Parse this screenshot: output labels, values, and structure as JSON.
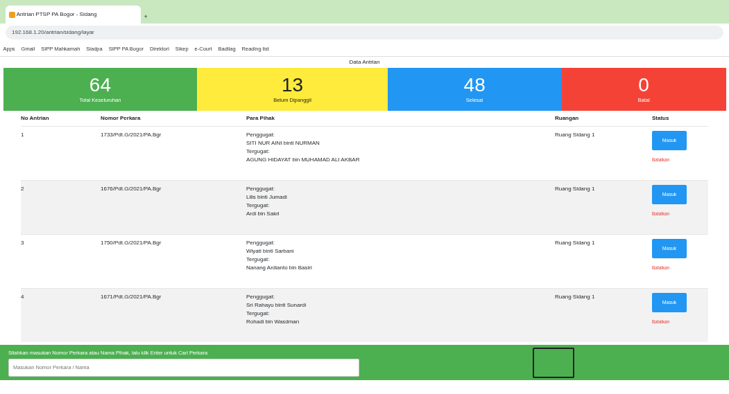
{
  "browser": {
    "tab_title": "Antrian PTSP PA Bogor - Sidang",
    "new_tab": "+",
    "url": "192.168.1.20/antrian/sidang/layar",
    "bookmarks": [
      "Apps",
      "Gmail",
      "SIPP Mahkamah",
      "Siadpa",
      "SIPP PA Bogor",
      "Direktori",
      "Sikep",
      "e-Court",
      "Badilag",
      "Reading list"
    ]
  },
  "page_title": "Data Antrian",
  "stats": [
    {
      "value": "64",
      "label": "Total Keseluruhan",
      "color": "#4caf50"
    },
    {
      "value": "13",
      "label": "Belum Dipanggil",
      "color": "#ffeb3b"
    },
    {
      "value": "48",
      "label": "Selesai",
      "color": "#2196f3"
    },
    {
      "value": "0",
      "label": "Batal",
      "color": "#f44336"
    }
  ],
  "table": {
    "columns": [
      "No Antrian",
      "Nomor Perkara",
      "Para Pihak",
      "Ruangan",
      "Status"
    ],
    "rows": [
      {
        "no": "1",
        "perkara": "1733/Pdt.G/2021/PA.Bgr",
        "pihak": [
          "Penggugat:",
          "SITI NUR AINI binti NURMAN",
          "Tergugat:",
          "AGUNG HIDAYAT bin MUHAMAD ALI AKBAR"
        ],
        "ruangan": "Ruang Sidang 1",
        "action": "Masuk",
        "link": "Batalkan"
      },
      {
        "no": "2",
        "perkara": "1676/Pdt.G/2021/PA.Bgr",
        "pihak": [
          "Penggugat:",
          "Lilis binti Jumadi",
          "Tergugat:",
          "Ardi bin Sakri"
        ],
        "ruangan": "Ruang Sidang 1",
        "action": "Masuk",
        "link": "Batalkan"
      },
      {
        "no": "3",
        "perkara": "1750/Pdt.G/2021/PA.Bgr",
        "pihak": [
          "Penggugat:",
          "Wiyati binti Sarbani",
          "Tergugat:",
          "Nanang Ardianto bin Basiri"
        ],
        "ruangan": "Ruang Sidang 1",
        "action": "Masuk",
        "link": "Batalkan"
      },
      {
        "no": "4",
        "perkara": "1671/Pdt.G/2021/PA.Bgr",
        "pihak": [
          "Penggugat:",
          "Sri Rahayu binti Sunardi",
          "Tergugat:",
          "Rohadi bin Wasdman"
        ],
        "ruangan": "Ruang Sidang 1",
        "action": "Masuk",
        "link": "Batalkan"
      }
    ]
  },
  "footer": {
    "hint": "Silahkan masukan Nomor Perkara atau Nama Pihak, lalu klik Enter untuk Cari Perkara",
    "placeholder": "Masukan Nomor Perkara / Nama"
  }
}
